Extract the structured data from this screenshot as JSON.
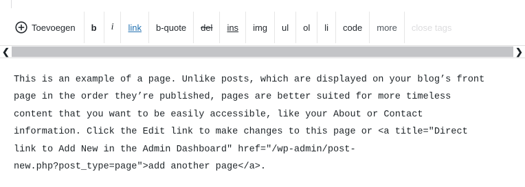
{
  "toolbar": {
    "add_label": "Toevoegen",
    "buttons": [
      "b",
      "i",
      "link",
      "b-quote",
      "del",
      "ins",
      "img",
      "ul",
      "ol",
      "li",
      "code",
      "more",
      "close tags"
    ]
  },
  "content": {
    "lines": [
      "This is an example of a page. Unlike posts, which are displayed on your blog’s front",
      "page in the order they’re published, pages are better suited for more timeless",
      "content that you want to be easily accessible, like your About or Contact",
      "information. Click the Edit link to make changes to this page or <a title=\"Direct",
      "link to Add New in the Admin Dashboard\" href=\"/wp-admin/post-",
      "new.php?post_type=page\">add another page</a>."
    ]
  },
  "colors": {
    "link": "#2271b1",
    "scrollbar_thumb": "#c3c4c7",
    "text": "#1d2327"
  },
  "icons": [
    "add-circle-icon",
    "scroll-left-arrow-icon",
    "scroll-right-arrow-icon"
  ]
}
